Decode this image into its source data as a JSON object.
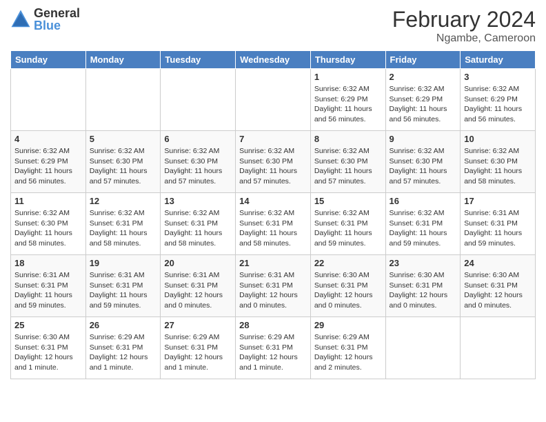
{
  "header": {
    "logo": {
      "line1": "General",
      "line2": "Blue"
    },
    "title": "February 2024",
    "subtitle": "Ngambe, Cameroon"
  },
  "days_of_week": [
    "Sunday",
    "Monday",
    "Tuesday",
    "Wednesday",
    "Thursday",
    "Friday",
    "Saturday"
  ],
  "weeks": [
    [
      {
        "day": "",
        "info": ""
      },
      {
        "day": "",
        "info": ""
      },
      {
        "day": "",
        "info": ""
      },
      {
        "day": "",
        "info": ""
      },
      {
        "day": "1",
        "info": "Sunrise: 6:32 AM\nSunset: 6:29 PM\nDaylight: 11 hours and 56 minutes."
      },
      {
        "day": "2",
        "info": "Sunrise: 6:32 AM\nSunset: 6:29 PM\nDaylight: 11 hours and 56 minutes."
      },
      {
        "day": "3",
        "info": "Sunrise: 6:32 AM\nSunset: 6:29 PM\nDaylight: 11 hours and 56 minutes."
      }
    ],
    [
      {
        "day": "4",
        "info": "Sunrise: 6:32 AM\nSunset: 6:29 PM\nDaylight: 11 hours and 56 minutes."
      },
      {
        "day": "5",
        "info": "Sunrise: 6:32 AM\nSunset: 6:30 PM\nDaylight: 11 hours and 57 minutes."
      },
      {
        "day": "6",
        "info": "Sunrise: 6:32 AM\nSunset: 6:30 PM\nDaylight: 11 hours and 57 minutes."
      },
      {
        "day": "7",
        "info": "Sunrise: 6:32 AM\nSunset: 6:30 PM\nDaylight: 11 hours and 57 minutes."
      },
      {
        "day": "8",
        "info": "Sunrise: 6:32 AM\nSunset: 6:30 PM\nDaylight: 11 hours and 57 minutes."
      },
      {
        "day": "9",
        "info": "Sunrise: 6:32 AM\nSunset: 6:30 PM\nDaylight: 11 hours and 57 minutes."
      },
      {
        "day": "10",
        "info": "Sunrise: 6:32 AM\nSunset: 6:30 PM\nDaylight: 11 hours and 58 minutes."
      }
    ],
    [
      {
        "day": "11",
        "info": "Sunrise: 6:32 AM\nSunset: 6:30 PM\nDaylight: 11 hours and 58 minutes."
      },
      {
        "day": "12",
        "info": "Sunrise: 6:32 AM\nSunset: 6:31 PM\nDaylight: 11 hours and 58 minutes."
      },
      {
        "day": "13",
        "info": "Sunrise: 6:32 AM\nSunset: 6:31 PM\nDaylight: 11 hours and 58 minutes."
      },
      {
        "day": "14",
        "info": "Sunrise: 6:32 AM\nSunset: 6:31 PM\nDaylight: 11 hours and 58 minutes."
      },
      {
        "day": "15",
        "info": "Sunrise: 6:32 AM\nSunset: 6:31 PM\nDaylight: 11 hours and 59 minutes."
      },
      {
        "day": "16",
        "info": "Sunrise: 6:32 AM\nSunset: 6:31 PM\nDaylight: 11 hours and 59 minutes."
      },
      {
        "day": "17",
        "info": "Sunrise: 6:31 AM\nSunset: 6:31 PM\nDaylight: 11 hours and 59 minutes."
      }
    ],
    [
      {
        "day": "18",
        "info": "Sunrise: 6:31 AM\nSunset: 6:31 PM\nDaylight: 11 hours and 59 minutes."
      },
      {
        "day": "19",
        "info": "Sunrise: 6:31 AM\nSunset: 6:31 PM\nDaylight: 11 hours and 59 minutes."
      },
      {
        "day": "20",
        "info": "Sunrise: 6:31 AM\nSunset: 6:31 PM\nDaylight: 12 hours and 0 minutes."
      },
      {
        "day": "21",
        "info": "Sunrise: 6:31 AM\nSunset: 6:31 PM\nDaylight: 12 hours and 0 minutes."
      },
      {
        "day": "22",
        "info": "Sunrise: 6:30 AM\nSunset: 6:31 PM\nDaylight: 12 hours and 0 minutes."
      },
      {
        "day": "23",
        "info": "Sunrise: 6:30 AM\nSunset: 6:31 PM\nDaylight: 12 hours and 0 minutes."
      },
      {
        "day": "24",
        "info": "Sunrise: 6:30 AM\nSunset: 6:31 PM\nDaylight: 12 hours and 0 minutes."
      }
    ],
    [
      {
        "day": "25",
        "info": "Sunrise: 6:30 AM\nSunset: 6:31 PM\nDaylight: 12 hours and 1 minute."
      },
      {
        "day": "26",
        "info": "Sunrise: 6:29 AM\nSunset: 6:31 PM\nDaylight: 12 hours and 1 minute."
      },
      {
        "day": "27",
        "info": "Sunrise: 6:29 AM\nSunset: 6:31 PM\nDaylight: 12 hours and 1 minute."
      },
      {
        "day": "28",
        "info": "Sunrise: 6:29 AM\nSunset: 6:31 PM\nDaylight: 12 hours and 1 minute."
      },
      {
        "day": "29",
        "info": "Sunrise: 6:29 AM\nSunset: 6:31 PM\nDaylight: 12 hours and 2 minutes."
      },
      {
        "day": "",
        "info": ""
      },
      {
        "day": "",
        "info": ""
      }
    ]
  ]
}
